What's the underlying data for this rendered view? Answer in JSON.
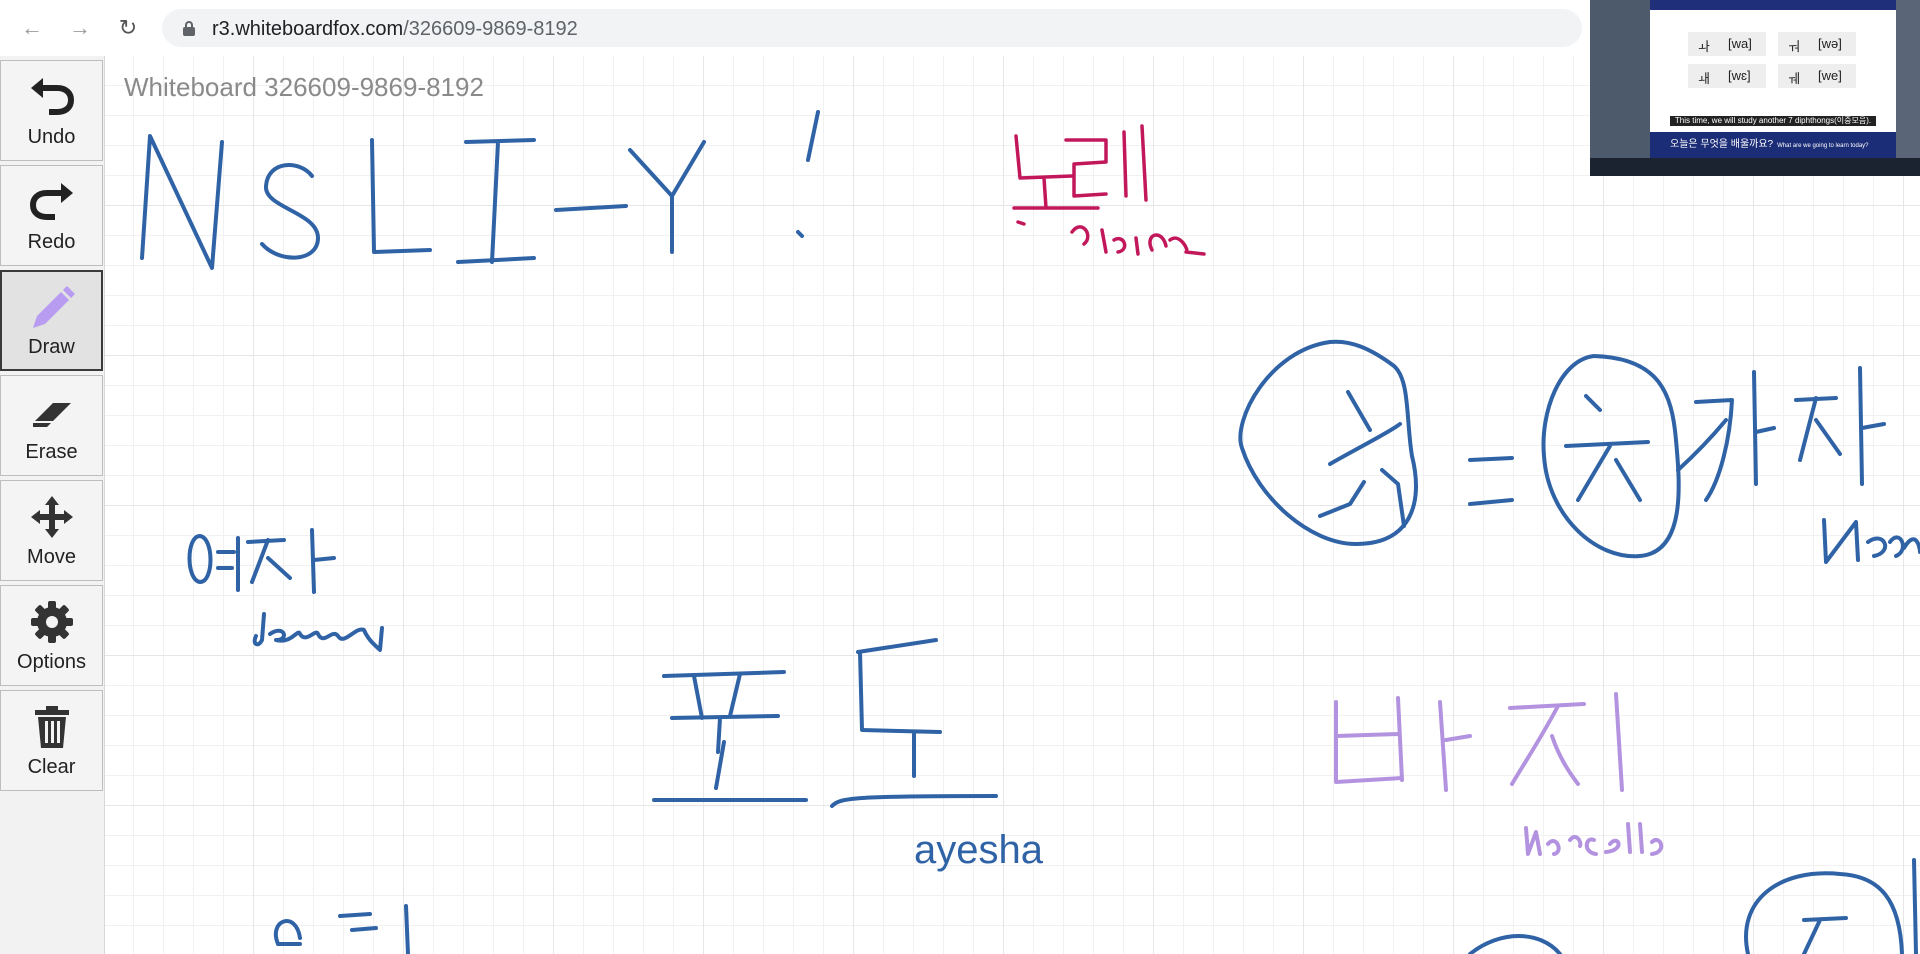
{
  "browser": {
    "url_domain": "r3.whiteboardfox.com",
    "url_path": "/326609-9869-8192"
  },
  "board": {
    "title": "Whiteboard 326609-9869-8192",
    "typed_label": "ayesha"
  },
  "toolbar": {
    "tools": [
      {
        "label": "Undo",
        "icon": "undo-icon"
      },
      {
        "label": "Redo",
        "icon": "redo-icon"
      },
      {
        "label": "Draw",
        "icon": "pencil-icon",
        "active": true,
        "accent": "#b79cf2"
      },
      {
        "label": "Erase",
        "icon": "eraser-icon"
      },
      {
        "label": "Move",
        "icon": "move-icon"
      },
      {
        "label": "Options",
        "icon": "gear-icon"
      },
      {
        "label": "Clear",
        "icon": "trash-icon"
      }
    ]
  },
  "colors": {
    "blue_ink": "#2f63a6",
    "magenta_ink": "#c2185b",
    "purple_ink": "#b393e0"
  },
  "video_overlay": {
    "cells": [
      {
        "hangul": "ㅘ",
        "phonetic": "[wa]"
      },
      {
        "hangul": "ㅝ",
        "phonetic": "[wə]"
      },
      {
        "hangul": "ㅙ",
        "phonetic": "[wɛ]"
      },
      {
        "hangul": "ㅞ",
        "phonetic": "[we]"
      }
    ],
    "caption": "This time, we will study another 7 diphthongs(이중모음).",
    "footer_title": "오늘은 무엇을 배울까요?",
    "footer_subtitle": "What are we going to learn today?"
  }
}
